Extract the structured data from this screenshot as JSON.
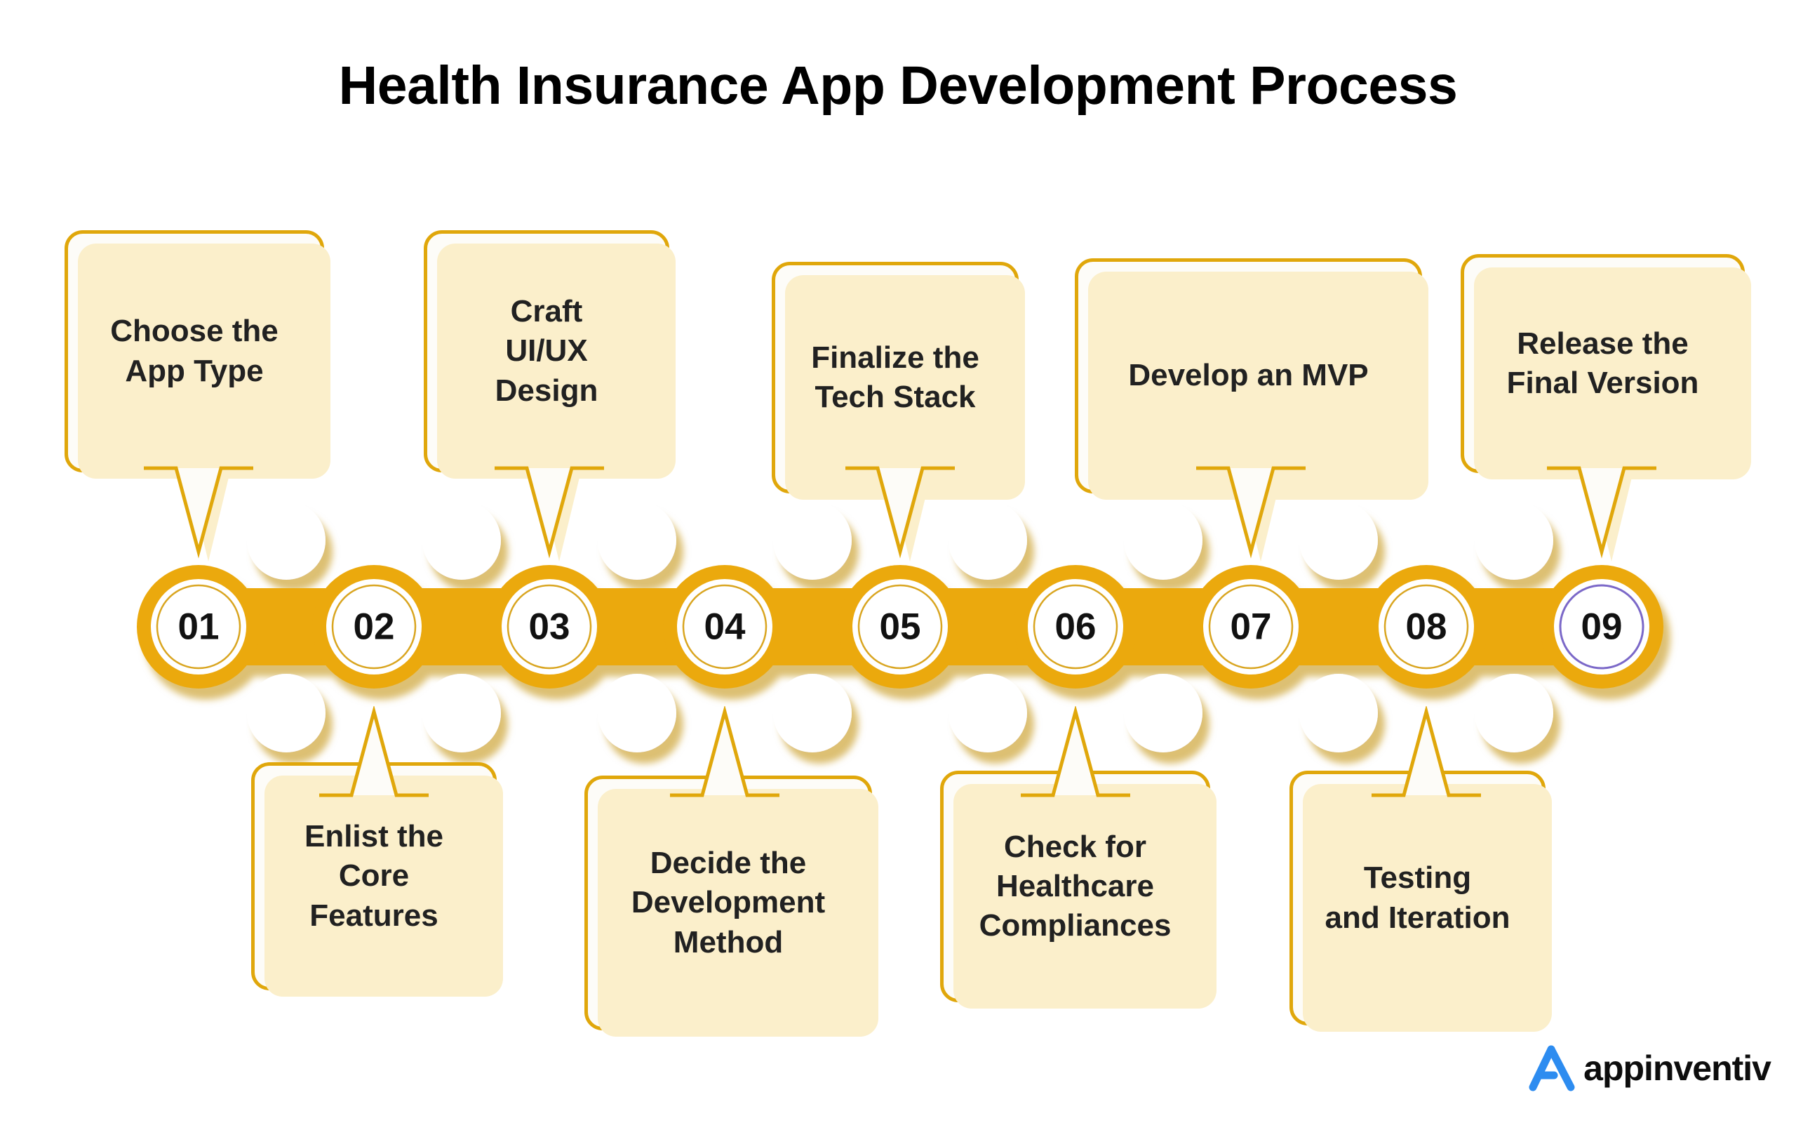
{
  "page": {
    "title": "Health Insurance App Development Process",
    "background_color": "#FFFFFF"
  },
  "theme": {
    "gold": "#EBA90B",
    "gold_border": "#E0A70B",
    "gold_shadow": "#D79A0A",
    "box_fill": "#FDFCF8",
    "box_shadow": "#FBEFCB",
    "text_color": "#212121",
    "ring_gold": "#D9A520",
    "ring_purple": "#7B68C8",
    "logo_blue": "#2D8CF0"
  },
  "chart_data": {
    "type": "diagram",
    "subtype": "numbered-process-chain",
    "title": "Health Insurance App Development Process",
    "step_count": 9,
    "steps": [
      {
        "number": "01",
        "label": "Choose the App Type",
        "lines": [
          "Choose the",
          "App Type"
        ],
        "position": "top",
        "ring_color": "#D9A520"
      },
      {
        "number": "02",
        "label": "Enlist the Core Features",
        "lines": [
          "Enlist the",
          "Core",
          "Features"
        ],
        "position": "bottom",
        "ring_color": "#D9A520"
      },
      {
        "number": "03",
        "label": "Craft UI/UX Design",
        "lines": [
          "Craft",
          "UI/UX",
          "Design"
        ],
        "position": "top",
        "ring_color": "#D9A520"
      },
      {
        "number": "04",
        "label": "Decide the Development Method",
        "lines": [
          "Decide the",
          "Development",
          "Method"
        ],
        "position": "bottom",
        "ring_color": "#D9A520"
      },
      {
        "number": "05",
        "label": "Finalize the Tech Stack",
        "lines": [
          "Finalize the",
          "Tech Stack"
        ],
        "position": "top",
        "ring_color": "#D9A520"
      },
      {
        "number": "06",
        "label": "Check for Healthcare Compliances",
        "lines": [
          "Check for",
          "Healthcare",
          "Compliances"
        ],
        "position": "bottom",
        "ring_color": "#D9A520"
      },
      {
        "number": "07",
        "label": "Develop an MVP",
        "lines": [
          "Develop an MVP"
        ],
        "position": "top",
        "ring_color": "#D9A520"
      },
      {
        "number": "08",
        "label": "Testing and Iteration",
        "lines": [
          "Testing",
          "and Iteration"
        ],
        "position": "bottom",
        "ring_color": "#D9A520"
      },
      {
        "number": "09",
        "label": "Release the Final Version",
        "lines": [
          "Release the",
          "Final Version"
        ],
        "position": "top",
        "ring_color": "#7B68C8"
      }
    ]
  },
  "steps_text": {
    "s1_l1": "Choose the",
    "s1_l2": "App Type",
    "s2_l1": "Enlist the",
    "s2_l2": "Core",
    "s2_l3": "Features",
    "s3_l1": "Craft",
    "s3_l2": "UI/UX",
    "s3_l3": "Design",
    "s4_l1": "Decide the",
    "s4_l2": "Development",
    "s4_l3": "Method",
    "s5_l1": "Finalize the",
    "s5_l2": "Tech Stack",
    "s6_l1": "Check for",
    "s6_l2": "Healthcare",
    "s6_l3": "Compliances",
    "s7_l1": "Develop an MVP",
    "s8_l1": "Testing",
    "s8_l2": "and Iteration",
    "s9_l1": "Release the",
    "s9_l2": "Final Version"
  },
  "numbers": {
    "n1": "01",
    "n2": "02",
    "n3": "03",
    "n4": "04",
    "n5": "05",
    "n6": "06",
    "n7": "07",
    "n8": "08",
    "n9": "09"
  },
  "logo": {
    "name": "appinventiv",
    "mark": "appinventiv-a-mark-icon"
  }
}
